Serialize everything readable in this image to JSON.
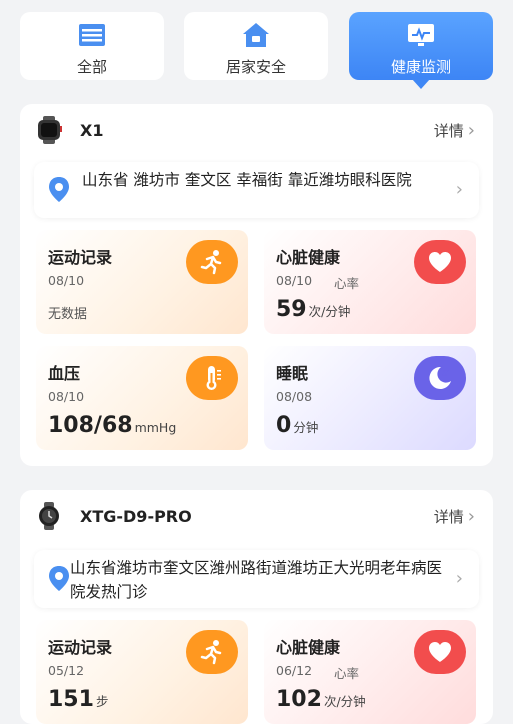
{
  "tabs": [
    {
      "label": "全部",
      "icon": "list-icon",
      "active": false
    },
    {
      "label": "居家安全",
      "icon": "home-icon",
      "active": false
    },
    {
      "label": "健康监测",
      "icon": "monitor-chart-icon",
      "active": true
    }
  ],
  "devices": [
    {
      "name": "X1",
      "icon": "watch-icon",
      "detail_label": "详情",
      "address": "山东省 潍坊市 奎文区 幸福街 靠近潍坊眼科医院",
      "tiles": {
        "activity": {
          "title": "运动记录",
          "date": "08/10",
          "empty_text": "无数据",
          "icon": "running-icon"
        },
        "heart": {
          "title": "心脏健康",
          "date": "08/10",
          "sub": "心率",
          "value": "59",
          "unit": "次/分钟",
          "icon": "heart-icon"
        },
        "blood": {
          "title": "血压",
          "date": "08/10",
          "value": "108/68",
          "unit": "mmHg",
          "icon": "thermometer-icon"
        },
        "sleep": {
          "title": "睡眠",
          "date": "08/08",
          "value": "0",
          "unit": "分钟",
          "icon": "moon-sleep-icon"
        }
      }
    },
    {
      "name": "XTG-D9-PRO",
      "icon": "watch-icon",
      "detail_label": "详情",
      "address": "山东省潍坊市奎文区潍州路街道潍坊正大光明老年病医院发热门诊",
      "tiles": {
        "activity": {
          "title": "运动记录",
          "date": "05/12",
          "value": "151",
          "unit": "步",
          "icon": "running-icon"
        },
        "heart": {
          "title": "心脏健康",
          "date": "06/12",
          "sub": "心率",
          "value": "102",
          "unit": "次/分钟",
          "icon": "heart-icon"
        }
      }
    }
  ],
  "colors": {
    "accent": "#3d85f5",
    "orange": "#ff9820",
    "red": "#f24d4d",
    "purple": "#6a63e8"
  }
}
